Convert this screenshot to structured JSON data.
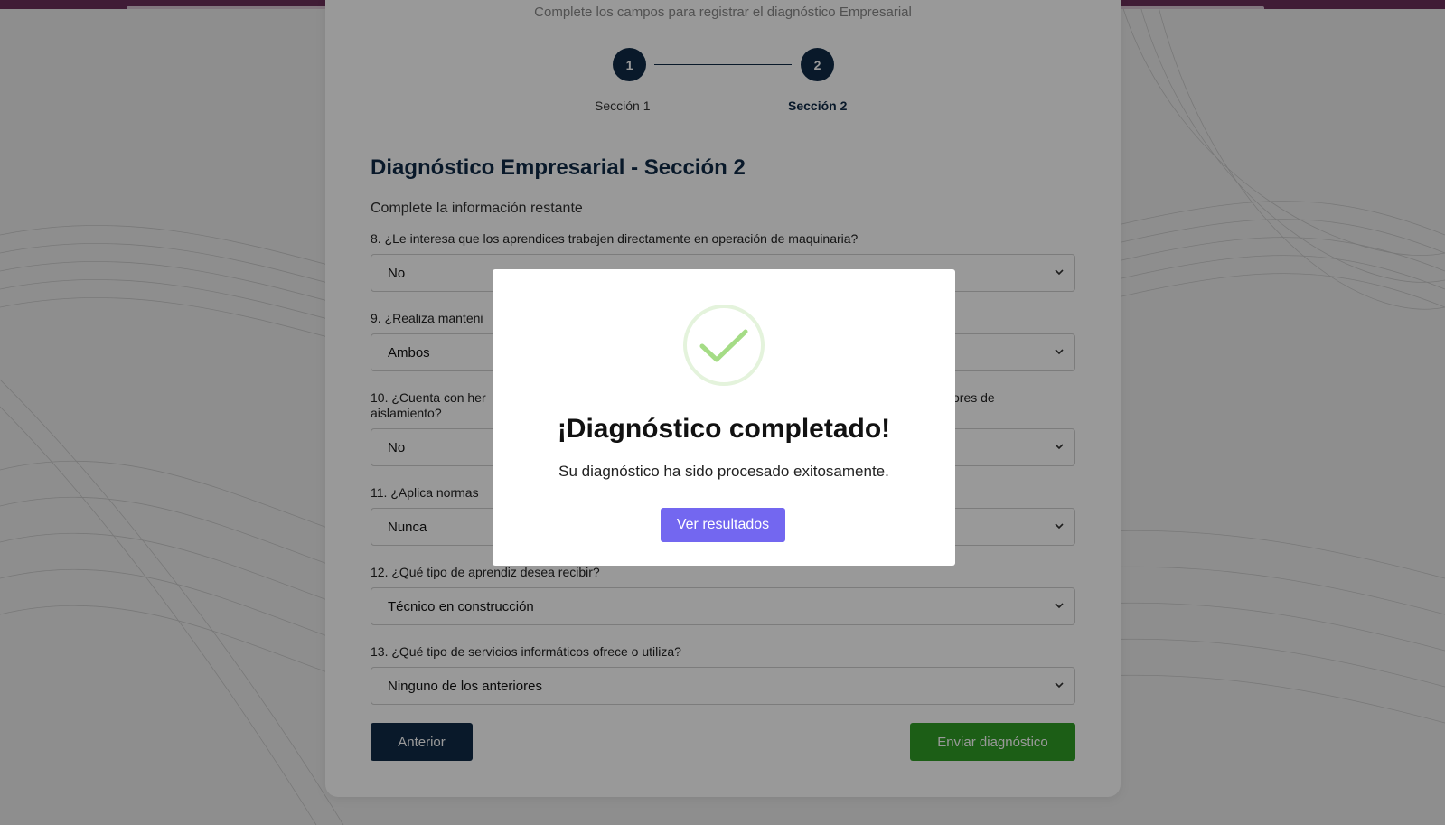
{
  "form": {
    "subtitle": "Complete los campos para registrar el diagnóstico Empresarial",
    "steps": [
      {
        "number": "1",
        "label": "Sección 1"
      },
      {
        "number": "2",
        "label": "Sección 2"
      }
    ],
    "title": "Diagnóstico Empresarial - Sección 2",
    "description": "Complete la información restante",
    "questions": [
      {
        "label": "8. ¿Le interesa que los aprendices trabajen directamente en operación de maquinaria?",
        "value": "No"
      },
      {
        "label": "9. ¿Realiza manteni",
        "label_right": "",
        "value": "Ambos"
      },
      {
        "label": "10. ¿Cuenta con her",
        "label_right": "ores de",
        "label_line2": "aislamiento?",
        "value": "No"
      },
      {
        "label": "11. ¿Aplica normas",
        "value": "Nunca"
      },
      {
        "label": "12. ¿Qué tipo de aprendiz desea recibir?",
        "value": "Técnico en construcción"
      },
      {
        "label": "13. ¿Qué tipo de servicios informáticos ofrece o utiliza?",
        "value": "Ninguno de los anteriores"
      }
    ],
    "prev_label": "Anterior",
    "submit_label": "Enviar diagnóstico"
  },
  "modal": {
    "icon": "check-circle-icon",
    "title": "¡Diagnóstico completado!",
    "message": "Su diagnóstico ha sido procesado exitosamente.",
    "button_label": "Ver resultados"
  },
  "colors": {
    "primary": "#0f2a47",
    "success_button": "#2f9d25",
    "modal_button": "#7367f0",
    "check_icon": "#a5dc86",
    "top_bar": "#6b2f5a"
  }
}
